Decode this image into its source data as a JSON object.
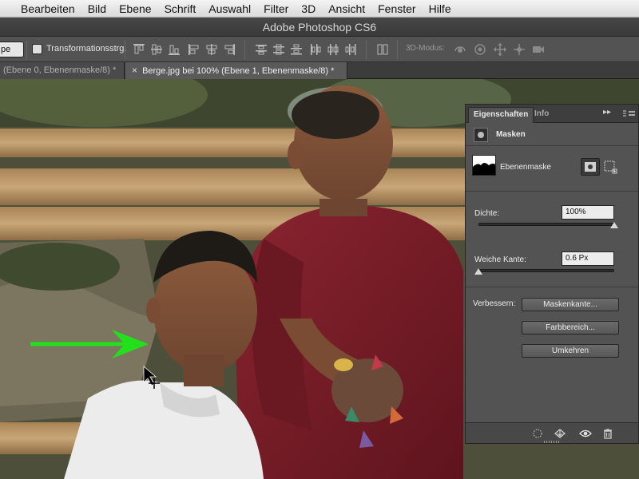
{
  "menubar": {
    "items": [
      "Bearbeiten",
      "Bild",
      "Ebene",
      "Schrift",
      "Auswahl",
      "Filter",
      "3D",
      "Ansicht",
      "Fenster",
      "Hilfe"
    ]
  },
  "window": {
    "title": "Adobe Photoshop CS6"
  },
  "options_bar": {
    "partial_select_value": "pe",
    "transform_controls_label": "Transformationsstrg.",
    "transform_controls_checked": false,
    "mode_3d_label": "3D-Modus:",
    "align_icons": [
      "align-top-icon",
      "align-vcenter-icon",
      "align-bottom-icon",
      "align-left-icon",
      "align-hcenter-icon",
      "align-right-icon",
      "distribute-top-icon",
      "distribute-vcenter-icon",
      "distribute-bottom-icon",
      "distribute-left-icon",
      "distribute-hcenter-icon",
      "distribute-right-icon",
      "auto-align-icon"
    ],
    "mode_3d_icons": [
      "rotate-3d-icon",
      "roll-3d-icon",
      "pan-3d-icon",
      "slide-3d-icon",
      "scale-3d-icon"
    ]
  },
  "tabs": [
    {
      "label": "(Ebene 0, Ebenenmaske/8) *",
      "active": false
    },
    {
      "label": "Berge.jpg bei 100% (Ebene 1, Ebenenmaske/8) *",
      "active": true
    }
  ],
  "properties_panel": {
    "tab_active": "Eigenschaften",
    "tab_inactive": "Info",
    "collapse_glyph": "▸▸",
    "section_title": "Masken",
    "layer_label": "Ebenenmaske",
    "density": {
      "label": "Dichte:",
      "value": "100%",
      "level": 1.0
    },
    "feather": {
      "label": "Weiche Kante:",
      "value": "0.6 Px",
      "level": 0.0
    },
    "refine_label": "Verbessern:",
    "buttons": [
      "Maskenkante...",
      "Farbbereich...",
      "Umkehren"
    ],
    "footer_icons": [
      "load-selection-icon",
      "apply-mask-icon",
      "eye-icon",
      "trash-icon"
    ]
  },
  "colors": {
    "arrow": "#22e01a",
    "panel_bg": "#535353",
    "robe": "#7a1f27"
  }
}
